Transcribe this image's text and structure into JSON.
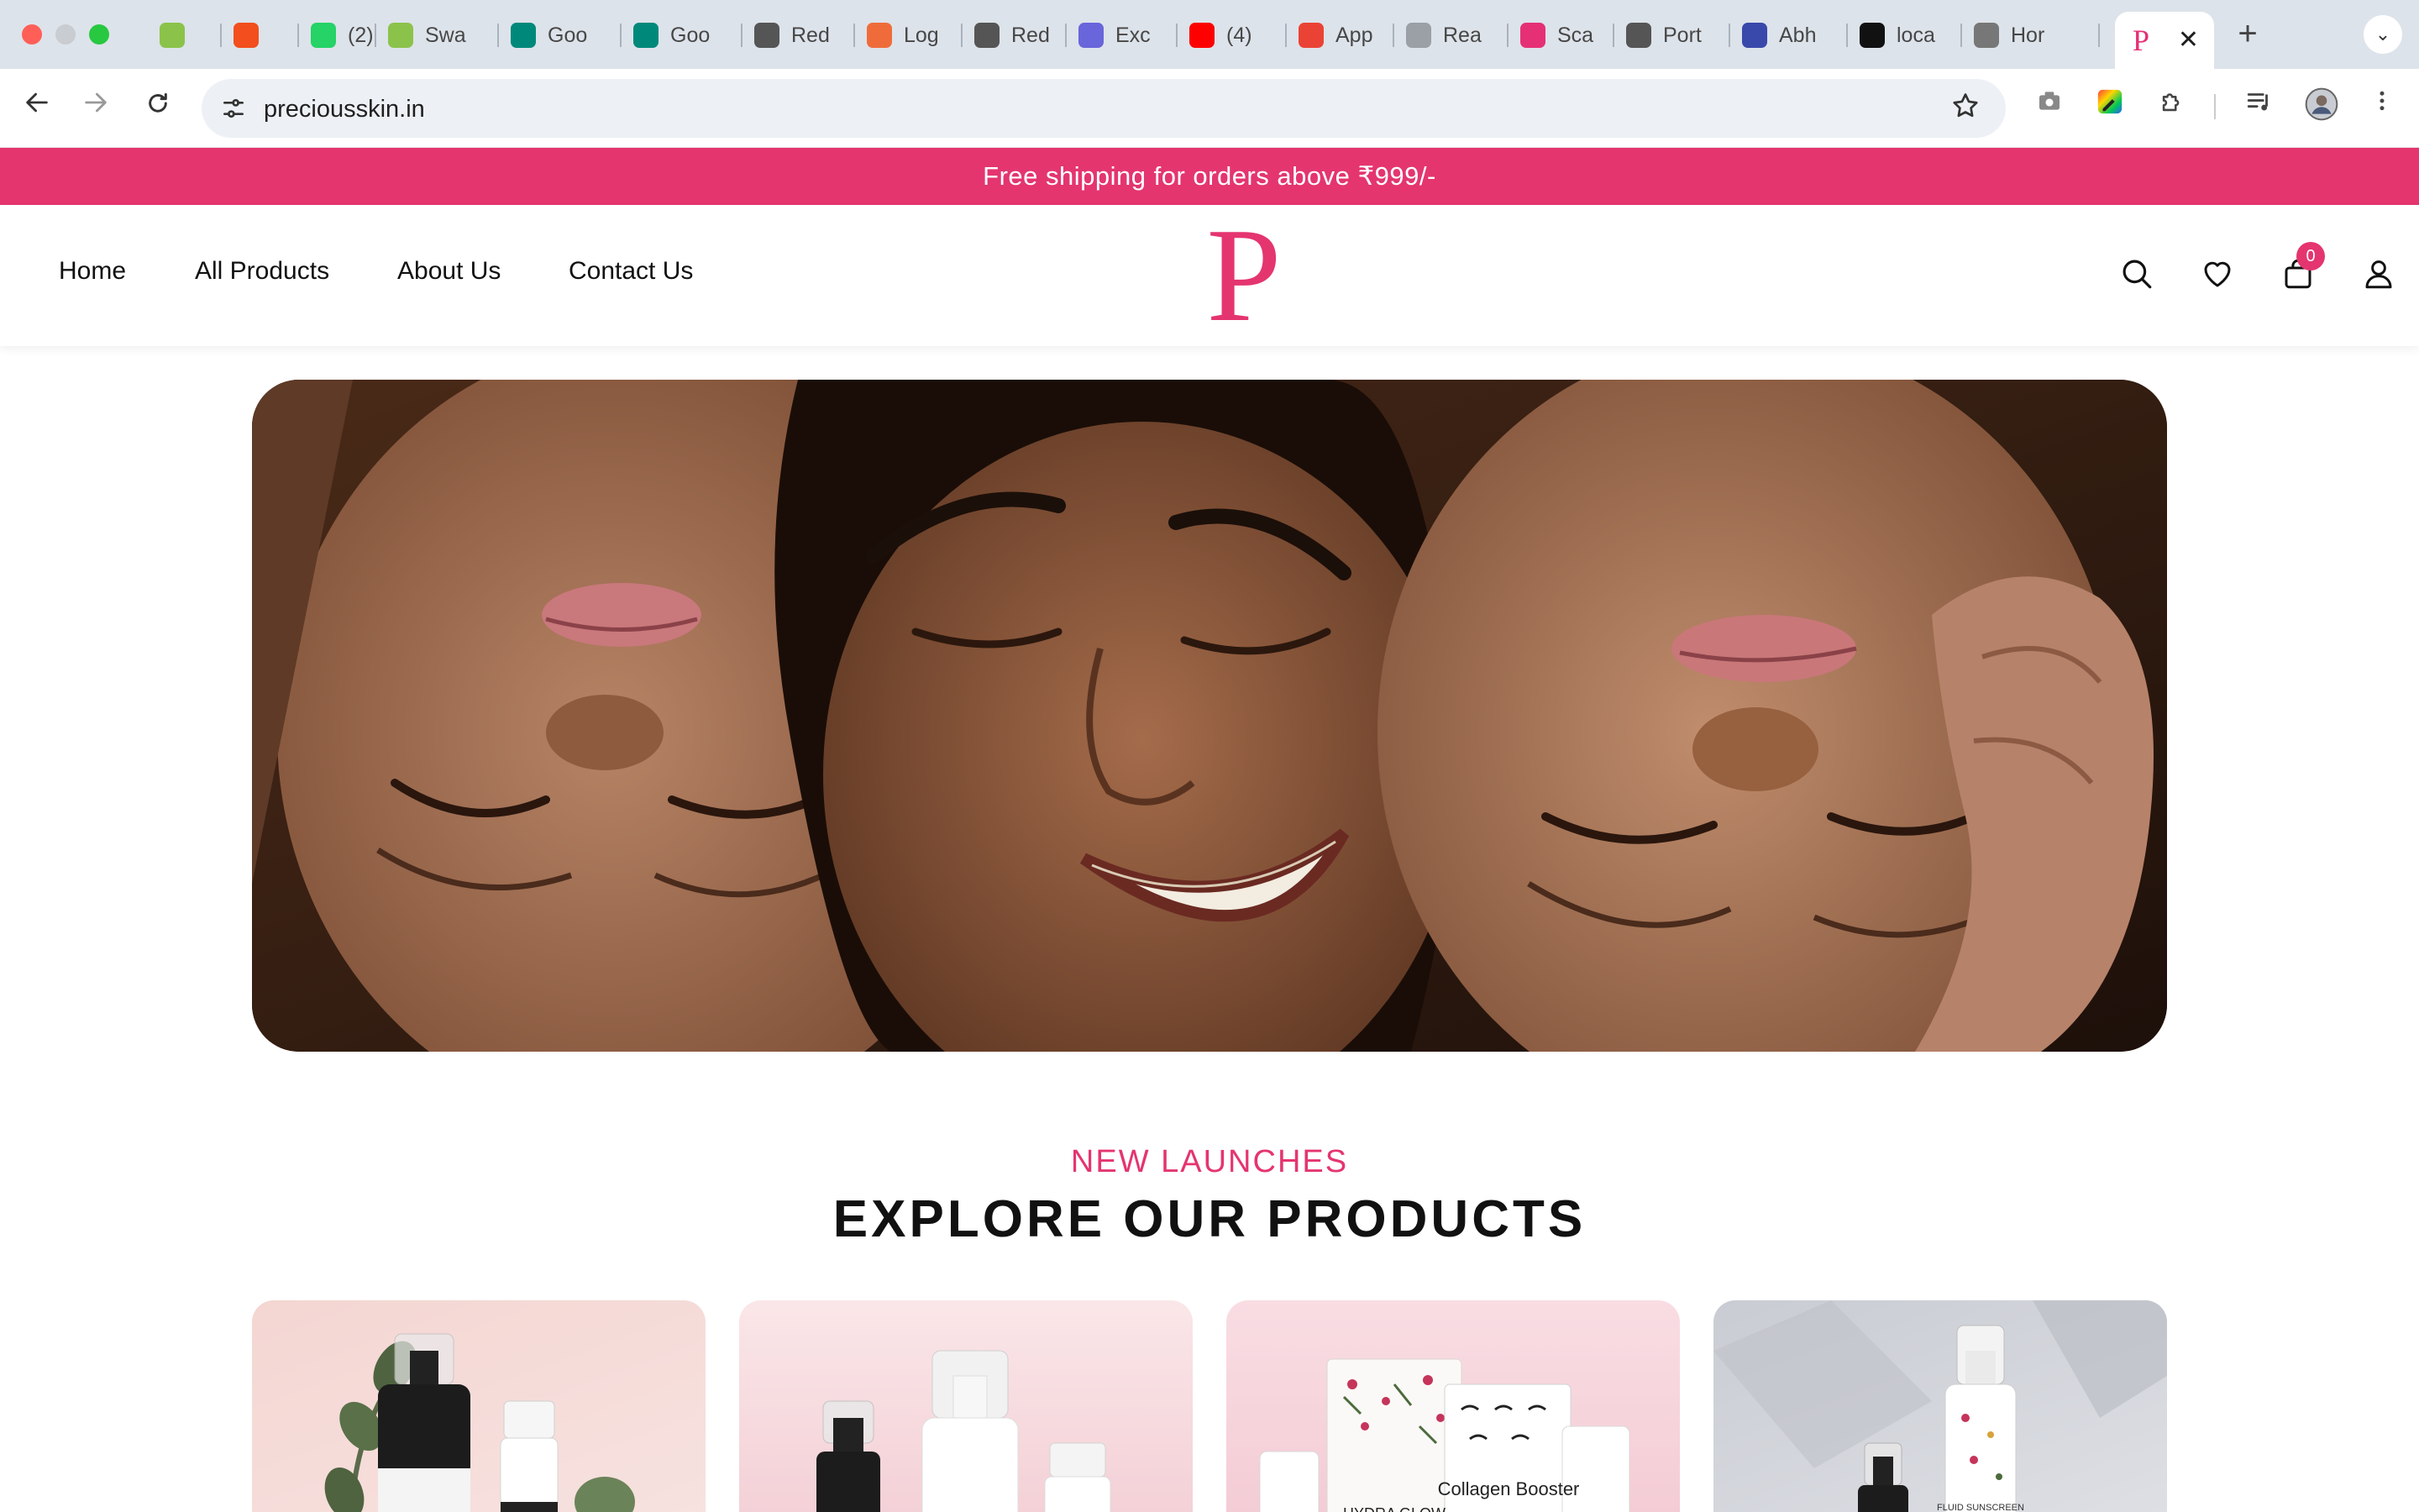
{
  "browser": {
    "tabs": [
      {
        "title": "",
        "icon": "globe-green-icon",
        "color": "#8bc34a"
      },
      {
        "title": "",
        "icon": "figma-icon",
        "color": "#f24e1e"
      },
      {
        "title": "(2) ’",
        "icon": "whatsapp-icon",
        "color": "#25d366"
      },
      {
        "title": "Swa",
        "icon": "globe-green-icon",
        "color": "#8bc34a"
      },
      {
        "title": "Goo",
        "icon": "google-meet-icon",
        "color": "#00897b"
      },
      {
        "title": "Goo",
        "icon": "google-meet-icon",
        "color": "#00897b"
      },
      {
        "title": "Red",
        "icon": "openai-icon",
        "color": "#555555"
      },
      {
        "title": "Log",
        "icon": "orange-logo-icon",
        "color": "#ef6c3a"
      },
      {
        "title": "Red",
        "icon": "openai-icon",
        "color": "#555555"
      },
      {
        "title": "Exc",
        "icon": "excalidraw-icon",
        "color": "#6965db"
      },
      {
        "title": "(4)",
        "icon": "youtube-icon",
        "color": "#ff0000"
      },
      {
        "title": "App",
        "icon": "gmail-icon",
        "color": "#ea4335"
      },
      {
        "title": "Rea",
        "icon": "cloud-icon",
        "color": "#9aa0a6"
      },
      {
        "title": "Sca",
        "icon": "cube-icon",
        "color": "#e53075"
      },
      {
        "title": "Port",
        "icon": "openai-icon",
        "color": "#555555"
      },
      {
        "title": "Abh",
        "icon": "arc-icon",
        "color": "#3949ab"
      },
      {
        "title": "loca",
        "icon": "triangle-icon",
        "color": "#111111"
      },
      {
        "title": "Hor",
        "icon": "globe-icon",
        "color": "#777777"
      }
    ],
    "active_tab": {
      "title": "P",
      "icon": "precious-logo-icon"
    },
    "url": "preciousskin.in"
  },
  "site": {
    "announcement": "Free shipping for orders above ₹999/-",
    "nav": {
      "home": "Home",
      "all_products": "All Products",
      "about": "About Us",
      "contact": "Contact Us"
    },
    "logo_letter": "P",
    "cart_count": "0",
    "brand_color": "#e4356f"
  },
  "section": {
    "eyebrow": "NEW LAUNCHES",
    "title": "EXPLORE OUR PRODUCTS"
  },
  "products": [
    {
      "label_1": "",
      "label_2": ""
    },
    {
      "label_1": "",
      "label_2": ""
    },
    {
      "label_1": "HYDRA GLOW",
      "label_2": "Collagen Booster"
    },
    {
      "label_1": "FLUID SUNSCREEN",
      "label_2": ""
    }
  ]
}
